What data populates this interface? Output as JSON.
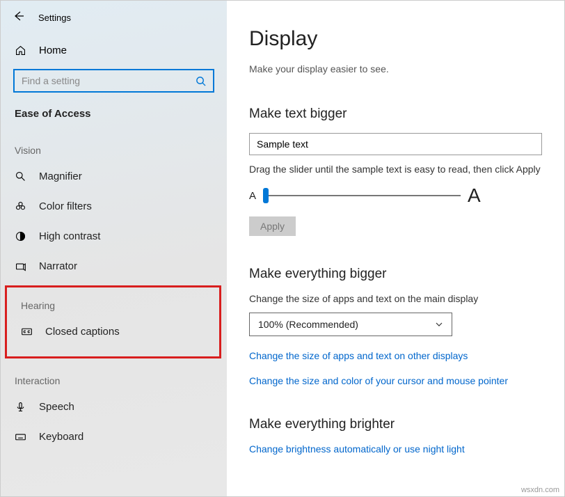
{
  "header": {
    "title": "Settings"
  },
  "home": {
    "label": "Home"
  },
  "search": {
    "placeholder": "Find a setting"
  },
  "group": "Ease of Access",
  "sections": {
    "vision": {
      "label": "Vision",
      "items": [
        "Magnifier",
        "Color filters",
        "High contrast",
        "Narrator"
      ]
    },
    "hearing": {
      "label": "Hearing",
      "items": [
        "Closed captions"
      ]
    },
    "interaction": {
      "label": "Interaction",
      "items": [
        "Speech",
        "Keyboard"
      ]
    }
  },
  "main": {
    "title": "Display",
    "subtitle": "Make your display easier to see.",
    "text_bigger": {
      "heading": "Make text bigger",
      "sample": "Sample text",
      "hint": "Drag the slider until the sample text is easy to read, then click Apply",
      "small_a": "A",
      "big_a": "A",
      "apply": "Apply"
    },
    "everything_bigger": {
      "heading": "Make everything bigger",
      "desc": "Change the size of apps and text on the main display",
      "selected": "100% (Recommended)",
      "link1": "Change the size of apps and text on other displays",
      "link2": "Change the size and color of your cursor and mouse pointer"
    },
    "brighter": {
      "heading": "Make everything brighter",
      "link": "Change brightness automatically or use night light"
    }
  },
  "watermark": "wsxdn.com"
}
